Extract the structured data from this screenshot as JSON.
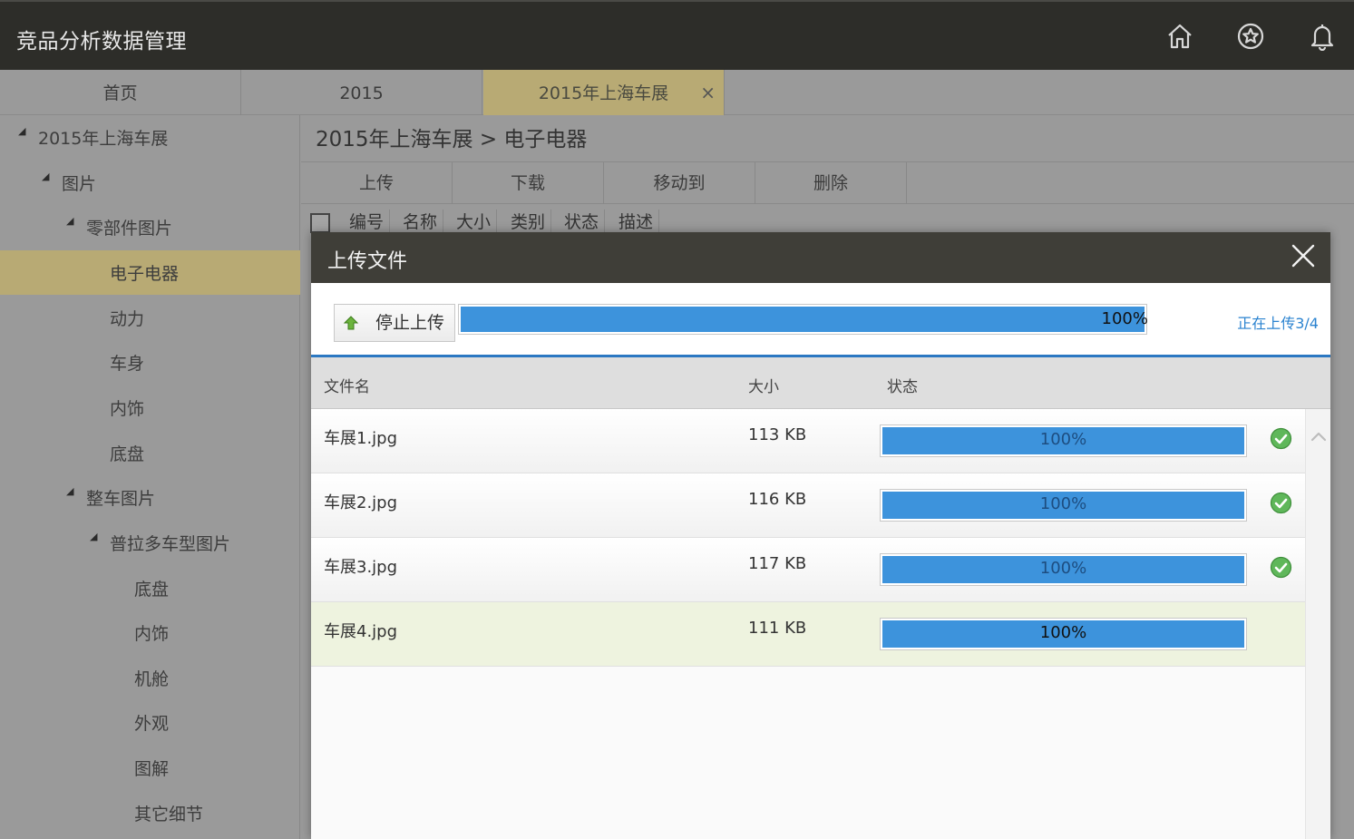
{
  "app": {
    "title": "竞品分析数据管理"
  },
  "top_icons": [
    "home-icon",
    "star-icon",
    "bell-icon"
  ],
  "tabs": [
    {
      "label": "首页"
    },
    {
      "label": "2015"
    },
    {
      "label": "2015年上海车展",
      "close": "×"
    }
  ],
  "sidebar": {
    "items": [
      {
        "label": "2015年上海车展"
      },
      {
        "label": "图片"
      },
      {
        "label": "零部件图片"
      },
      {
        "label": "电子电器"
      },
      {
        "label": "动力"
      },
      {
        "label": "车身"
      },
      {
        "label": "内饰"
      },
      {
        "label": "底盘"
      },
      {
        "label": "整车图片"
      },
      {
        "label": "普拉多车型图片"
      },
      {
        "label": "底盘"
      },
      {
        "label": "内饰"
      },
      {
        "label": "机舱"
      },
      {
        "label": "外观"
      },
      {
        "label": "图解"
      },
      {
        "label": "其它细节"
      }
    ]
  },
  "breadcrumb": "2015年上海车展 > 电子电器",
  "toolbar": {
    "upload": "上传",
    "download": "下载",
    "move": "移动到",
    "delete": "删除"
  },
  "columns": [
    "编号",
    "名称",
    "大小",
    "类别",
    "状态",
    "描述"
  ],
  "modal": {
    "title": "上传文件",
    "stop_button": "停止上传",
    "overall_progress": 1.0,
    "overall_label": "100%",
    "status_text": "正在上传3/4",
    "header": {
      "name": "文件名",
      "size": "大小",
      "status": "状态"
    },
    "files": [
      {
        "name": "车展1.jpg",
        "size": "113 KB",
        "progress": 1.0,
        "label": "100%",
        "done": true
      },
      {
        "name": "车展2.jpg",
        "size": "116 KB",
        "progress": 1.0,
        "label": "100%",
        "done": true
      },
      {
        "name": "车展3.jpg",
        "size": "117 KB",
        "progress": 1.0,
        "label": "100%",
        "done": true
      },
      {
        "name": "车展4.jpg",
        "size": "111 KB",
        "progress": 1.0,
        "label": "100%",
        "done": false
      }
    ]
  },
  "colors": {
    "accent": "#b8aa74",
    "progress": "#3d93dc",
    "topbar": "#2d2d29",
    "ok": "#5fb75a"
  }
}
